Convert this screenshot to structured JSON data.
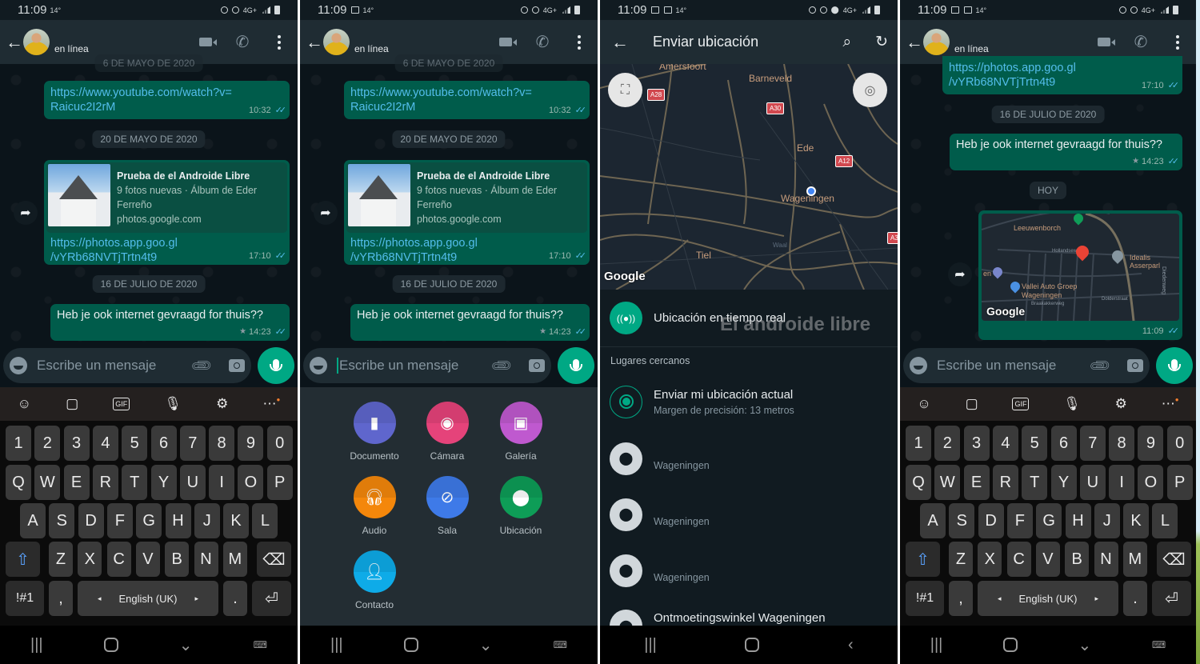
{
  "status_bar": {
    "time": "11:09",
    "temperature": "14°",
    "network": "4G+"
  },
  "chat_header": {
    "contact_status": "en línea",
    "back_icon": "arrow-left-icon",
    "video_icon": "video-call-icon",
    "call_icon": "phone-icon",
    "menu_icon": "more-vertical-icon"
  },
  "chat": {
    "date_chip_top_partial": "6 DE MAYO DE 2020",
    "messages": [
      {
        "type": "link",
        "text_line1": "https://www.youtube.com/watch?v=",
        "text_line2": "Raicuc2I2rM",
        "time": "10:32",
        "status": "read"
      },
      {
        "date_chip": "20 DE MAYO DE 2020"
      },
      {
        "type": "link_preview",
        "preview_title": "Prueba de el Androide Libre",
        "preview_desc_line1": "9 fotos nuevas · Álbum de Eder",
        "preview_desc_line2": "Ferreño",
        "preview_domain": "photos.google.com",
        "text_line1": "https://photos.app.goo.gl",
        "text_line2": "/vYRb68NVTjTrtn4t9",
        "time": "17:10",
        "status": "read"
      },
      {
        "date_chip": "16 DE JULIO DE 2020"
      },
      {
        "type": "text",
        "text": "Heb je ook internet gevraagd for thuis??",
        "time": "14:23",
        "starred": true,
        "status": "read"
      },
      {
        "date_chip": "HOY"
      },
      {
        "type": "location",
        "time": "11:09",
        "status": "read",
        "map_labels": [
          "Leeuwenborch",
          "Idealis Asserparl",
          "Vallei Auto Groep",
          "Wageningen",
          "Braakakkerweg",
          "Diedenweg",
          "Dolderstraat",
          "Hollandsew",
          "en"
        ],
        "map_brand": "Google"
      }
    ]
  },
  "composer": {
    "placeholder": "Escribe un mensaje",
    "emoji_icon": "emoji-icon",
    "attach_icon": "paperclip-icon",
    "camera_icon": "camera-icon",
    "mic_icon": "microphone-icon"
  },
  "keyboard": {
    "toolbar": [
      "emoji-icon",
      "sticker-icon",
      "GIF",
      "microphone-icon",
      "settings-gear-icon",
      "more-icon"
    ],
    "rows": [
      [
        "1",
        "2",
        "3",
        "4",
        "5",
        "6",
        "7",
        "8",
        "9",
        "0"
      ],
      [
        "Q",
        "W",
        "E",
        "R",
        "T",
        "Y",
        "U",
        "I",
        "O",
        "P"
      ],
      [
        "A",
        "S",
        "D",
        "F",
        "G",
        "H",
        "J",
        "K",
        "L"
      ],
      [
        "Z",
        "X",
        "C",
        "V",
        "B",
        "N",
        "M"
      ]
    ],
    "symbols_key": "!#1",
    "comma_key": ",",
    "space_label": "English (UK)",
    "period_key": ".",
    "shift_icon": "shift-icon",
    "backspace_icon": "backspace-icon",
    "enter_icon": "enter-icon"
  },
  "attach_menu": {
    "items": [
      {
        "label": "Documento",
        "icon": "document-icon",
        "color": "#5f66cd"
      },
      {
        "label": "Cámara",
        "icon": "camera-icon",
        "color": "#e5437a"
      },
      {
        "label": "Galería",
        "icon": "gallery-icon",
        "color": "#bf59cf"
      },
      {
        "label": "Audio",
        "icon": "headphones-icon",
        "color": "#f4870b"
      },
      {
        "label": "Sala",
        "icon": "room-icon",
        "color": "#3e7ae8"
      },
      {
        "label": "Ubicación",
        "icon": "location-pin-icon",
        "color": "#0e9d57"
      },
      {
        "label": "Contacto",
        "icon": "contact-icon",
        "color": "#0eabe8"
      }
    ]
  },
  "send_location": {
    "title": "Enviar ubicación",
    "map_labels": {
      "amersfoort": "Amersfoort",
      "barneveld": "Barneveld",
      "ede": "Ede",
      "wageningen": "Wageningen",
      "tiel": "Tiel",
      "waal": "Waal"
    },
    "road_shields": [
      "A28",
      "A30",
      "A12",
      "A3"
    ],
    "map_brand": "Google",
    "live_location": "Ubicación en tiempo real",
    "nearby_header": "Lugares cercanos",
    "current_location": "Enviar mi ubicación actual",
    "accuracy": "Margen de precisión: 13 metros",
    "places": [
      "Wageningen",
      "Wageningen",
      "Wageningen",
      "Ontmoetingswinkel Wageningen"
    ],
    "watermark": "El androide libre"
  },
  "colors": {
    "accent": "#00a884",
    "bubble_out": "#005c4b",
    "app_bar": "#1f2c33",
    "chat_bg": "#0b141a",
    "link": "#53bdeb"
  }
}
